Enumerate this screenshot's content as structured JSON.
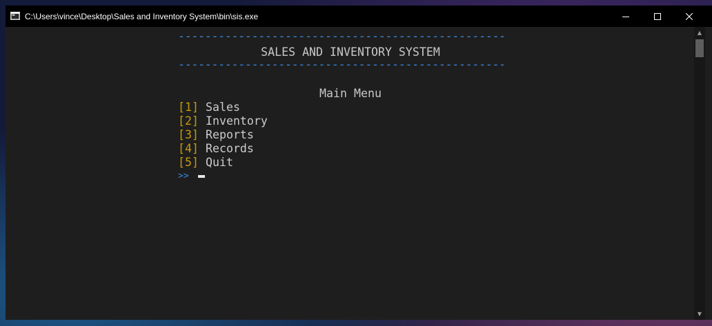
{
  "window": {
    "title": "C:\\Users\\vince\\Desktop\\Sales and Inventory System\\bin\\sis.exe",
    "icon": "console-app-icon",
    "controls": [
      "minimize-icon",
      "maximize-icon",
      "close-icon"
    ]
  },
  "console": {
    "rule": "-------------------------------------------------",
    "heading": "SALES AND INVENTORY SYSTEM",
    "menu_title": "Main Menu",
    "options": [
      {
        "key": "[1]",
        "label": "Sales"
      },
      {
        "key": "[2]",
        "label": "Inventory"
      },
      {
        "key": "[3]",
        "label": "Reports"
      },
      {
        "key": "[4]",
        "label": "Records"
      },
      {
        "key": "[5]",
        "label": "Quit"
      }
    ],
    "prompt": ">>"
  },
  "colors": {
    "rule": "#3a86d8",
    "option_key": "#c79b0d",
    "text": "#cccccc",
    "console_bg": "#1e1e1e"
  }
}
